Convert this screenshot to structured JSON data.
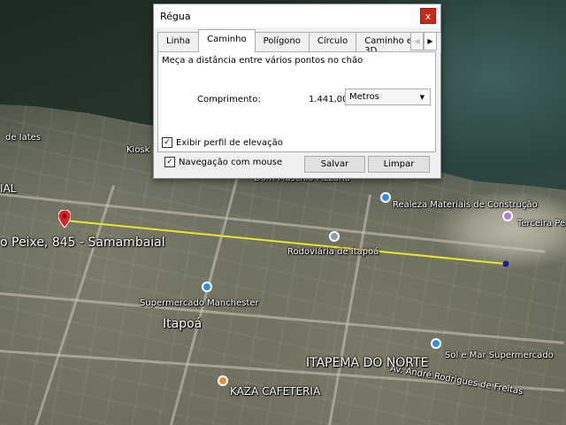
{
  "dialog": {
    "title": "Régua",
    "close": "x",
    "tabs": [
      "Linha",
      "Caminho",
      "Polígono",
      "Círculo",
      "Caminho em 3D"
    ],
    "active_tab": "Caminho",
    "description": "Meça a distância entre vários pontos no chão",
    "length_label": "Comprimento:",
    "length_value": "1.441,00",
    "unit": "Metros",
    "elevation_profile_label": "Exibir perfil de elevação",
    "elevation_profile_checked": true,
    "mouse_navigation_label": "Navegação com mouse",
    "mouse_navigation_checked": true,
    "save_button": "Salvar",
    "clear_button": "Limpar"
  },
  "map": {
    "labels": {
      "kiosk": "Kiosk",
      "dom_maschio": "Dom Maschio Pizzaria",
      "realeza": "Realeza Materiais de Construção",
      "terceira": "Terceira Pedra",
      "peixe": "o Peixe, 845 - Samambaial",
      "rodoviaria": "Rodoviária de Itapoá",
      "supermercado": "Supermercado Manchester",
      "itapoa": "Itapoá",
      "itapema": "ITAPEMA DO NORTE",
      "sol_mar": "Sol e Mar Supermercado",
      "kaza": "KAZA CAFETERIA",
      "rodrigues": "Av. André Rodrigues de Freitas",
      "de_iates": "de Iates",
      "ial": "IAL"
    },
    "path_color": "#e8e82a",
    "start_marker_color": "#d9252a",
    "end_marker_color": "#1a1f9a"
  }
}
